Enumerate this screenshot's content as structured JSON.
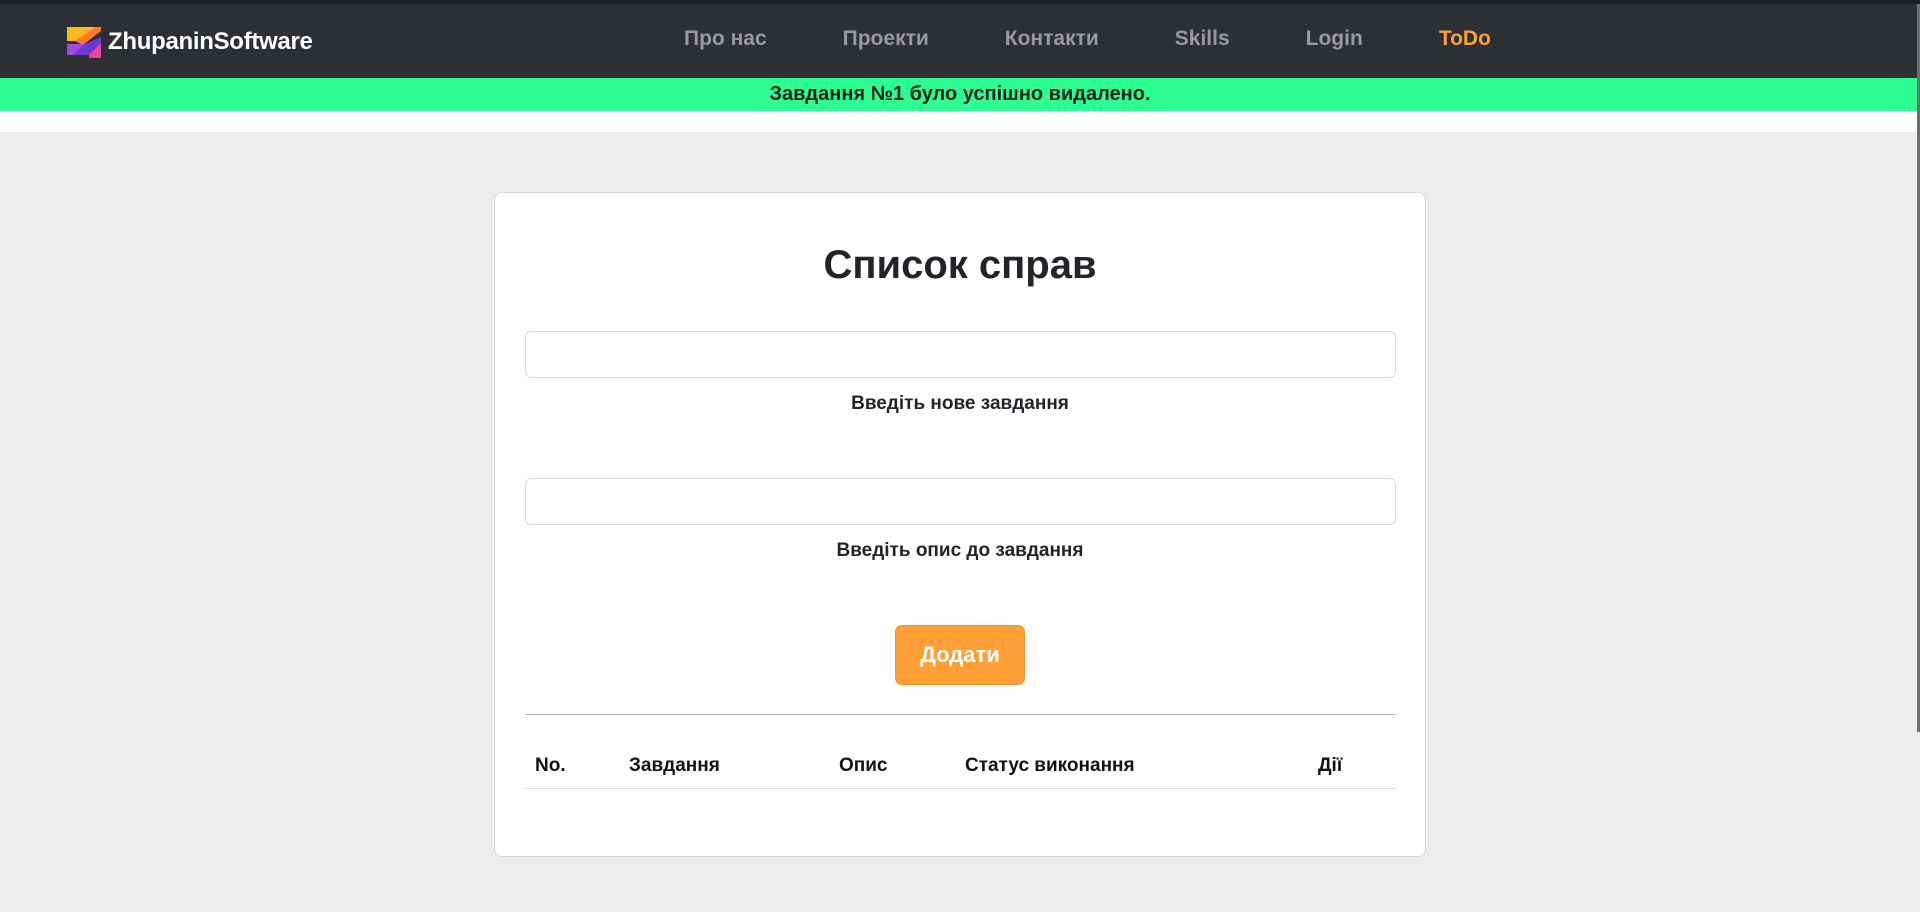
{
  "navbar": {
    "brand": "ZhupaninSoftware",
    "links": [
      {
        "label": "Про нас",
        "active": false
      },
      {
        "label": "Проекти",
        "active": false
      },
      {
        "label": "Контакти",
        "active": false
      },
      {
        "label": "Skills",
        "active": false
      },
      {
        "label": "Login",
        "active": false
      },
      {
        "label": "ToDo",
        "active": true
      }
    ]
  },
  "alert": {
    "message": "Завдання №1 було успішно видалено."
  },
  "card": {
    "title": "Список справ",
    "task_input": {
      "value": "",
      "label": "Введіть нове завдання"
    },
    "description_input": {
      "value": "",
      "label": "Введіть опис до завдання"
    },
    "add_button": "Додати",
    "table": {
      "headers": [
        "No.",
        "Завдання",
        "Опис",
        "Статус виконання",
        "Дії"
      ],
      "rows": []
    }
  },
  "colors": {
    "navbar_bg": "#2c3035",
    "accent": "#ff9f38",
    "alert_bg": "#2dfd90",
    "page_bg": "#ededed"
  }
}
